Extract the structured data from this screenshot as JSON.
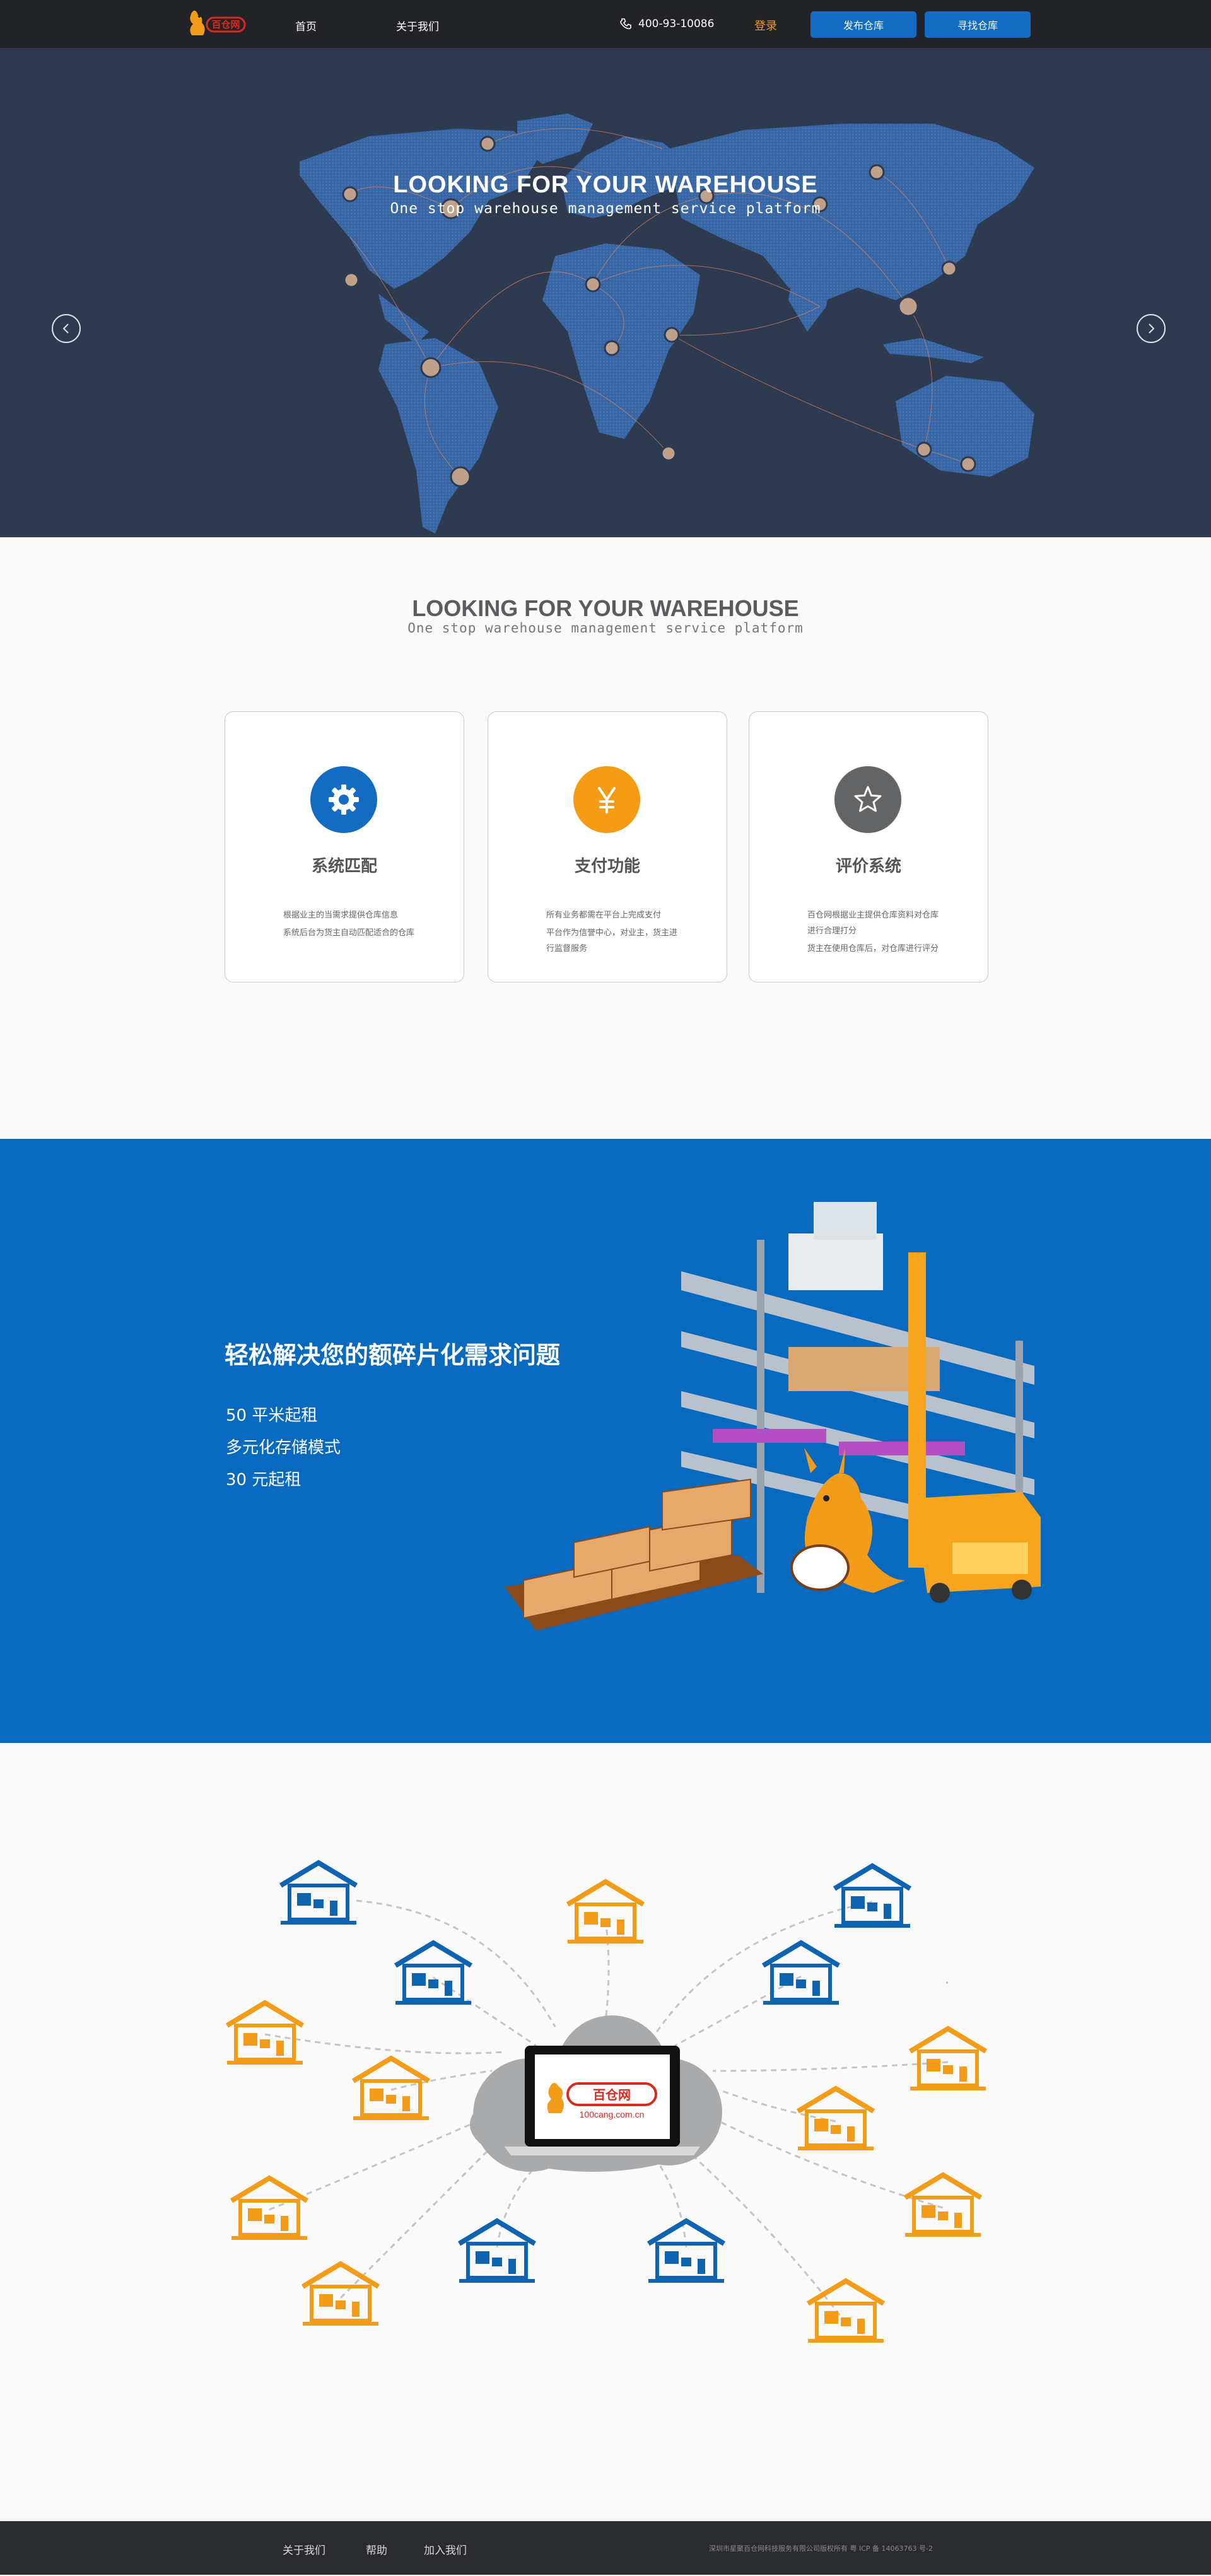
{
  "nav": {
    "logo_name": "百仓网",
    "home": "首页",
    "about": "关于我们",
    "phone": "400-93-10086",
    "login": "登录",
    "publish": "发布仓库",
    "find": "寻找仓库"
  },
  "hero": {
    "title": "LOOKING FOR YOUR WAREHOUSE",
    "subtitle": "One stop warehouse management service platform",
    "slides_total": 3,
    "active_slide": 1
  },
  "features": {
    "title": "LOOKING FOR YOUR WAREHOUSE",
    "subtitle": "One stop warehouse management service platform",
    "cards": [
      {
        "icon": "gear-icon",
        "color": "#136bc2",
        "title": "系统匹配",
        "desc": [
          "根据业主的当需求提供仓库信息",
          "系统后台为货主自动匹配适合的仓库"
        ]
      },
      {
        "icon": "yen-icon",
        "color": "#f69b14",
        "title": "支付功能",
        "desc": [
          "所有业务都需在平台上完成支付",
          "平台作为信誉中心，对业主，货主进行监督服务"
        ]
      },
      {
        "icon": "star-icon",
        "color": "#636466",
        "title": "评价系统",
        "desc": [
          "百仓网根据业主提供仓库资料对仓库进行合理打分",
          "货主在使用仓库后，对仓库进行评分"
        ]
      }
    ]
  },
  "band": {
    "title": "轻松解决您的额碎片化需求问题",
    "items": [
      "50 平米起租",
      "多元化存储模式",
      "30 元起租"
    ]
  },
  "network": {
    "laptop_logo": "百仓网",
    "laptop_url": "100cang.com.cn",
    "colors": {
      "blue": "#0f64b2",
      "orange": "#f39c1a",
      "cloud": "#a9aaac"
    }
  },
  "footer": {
    "about": "关于我们",
    "help": "帮助",
    "join": "加入我们",
    "copyright": "深圳市星聚百仓网科技服务有限公司版权所有    粤 ICP 备 14063763 号-2"
  }
}
